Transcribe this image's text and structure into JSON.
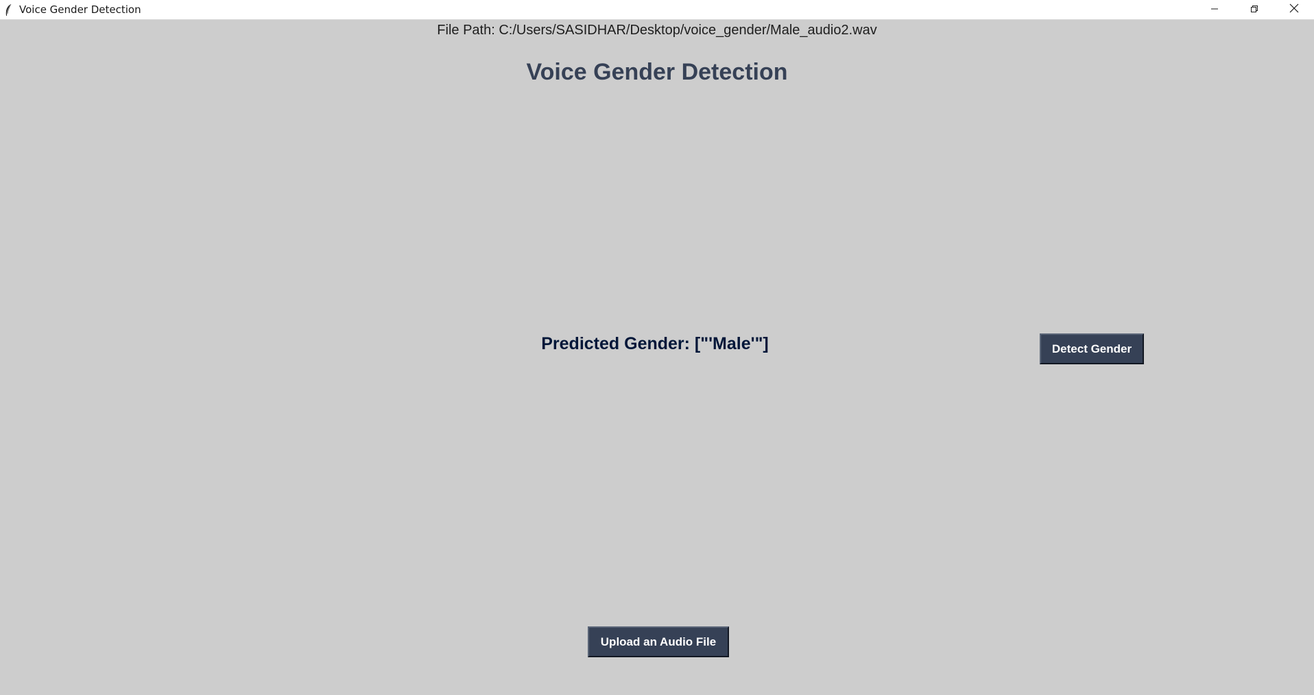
{
  "window": {
    "title": "Voice Gender Detection",
    "icon": "feather-icon",
    "controls": [
      "minimize-icon",
      "restore-icon",
      "close-icon"
    ]
  },
  "main": {
    "file_path": "File Path: C:/Users/SASIDHAR/Desktop/voice_gender/Male_audio2.wav",
    "heading": "Voice Gender Detection",
    "predicted_gender": "Predicted Gender: [\"'Male'\"]",
    "detect_button_label": "Detect Gender",
    "upload_button_label": "Upload an Audio File"
  },
  "colors": {
    "background": "#cdcdcd",
    "heading": "#364156",
    "prediction": "#011638",
    "button": "#364156",
    "button_text": "#ffffff"
  }
}
